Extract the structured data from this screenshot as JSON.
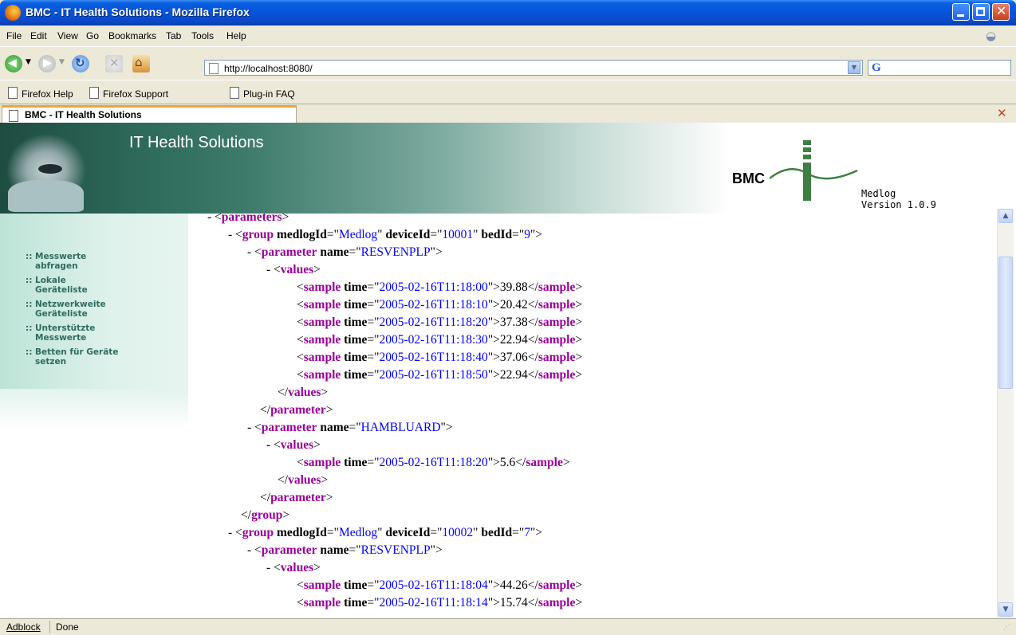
{
  "window": {
    "title": "BMC - IT Health Solutions - Mozilla Firefox"
  },
  "menu": [
    "File",
    "Edit",
    "View",
    "Go",
    "Bookmarks",
    "Tab",
    "Tools",
    "Help"
  ],
  "nav": {
    "url": "http://localhost:8080/",
    "search_engine": "G"
  },
  "bookmarks": [
    "Firefox Help",
    "Firefox Support",
    "Plug-in FAQ"
  ],
  "tab": {
    "label": "BMC - IT Health Solutions"
  },
  "page": {
    "banner_title": "IT Health Solutions",
    "logo_text": "BMC",
    "product": "Medlog",
    "version": "Version 1.0.9",
    "sidebar": [
      {
        "line1": "Messwerte",
        "line2": "abfragen"
      },
      {
        "line1": "Lokale",
        "line2": "Geräteliste"
      },
      {
        "line1": "Netzwerkweite",
        "line2": "Geräteliste"
      },
      {
        "line1": "Unterstützte",
        "line2": "Messwerte"
      },
      {
        "line1": "Betten für Geräte",
        "line2": "setzen"
      }
    ],
    "bullet": "::"
  },
  "xml": {
    "root_tag": "parameters",
    "groups": [
      {
        "medlogId": "Medlog",
        "deviceId": "10001",
        "bedId": "9",
        "parameters": [
          {
            "name": "RESVENPLP",
            "samples": [
              {
                "time": "2005-02-16T11:18:00",
                "value": "39.88"
              },
              {
                "time": "2005-02-16T11:18:10",
                "value": "20.42"
              },
              {
                "time": "2005-02-16T11:18:20",
                "value": "37.38"
              },
              {
                "time": "2005-02-16T11:18:30",
                "value": "22.94"
              },
              {
                "time": "2005-02-16T11:18:40",
                "value": "37.06"
              },
              {
                "time": "2005-02-16T11:18:50",
                "value": "22.94"
              }
            ]
          },
          {
            "name": "HAMBLUARD",
            "samples": [
              {
                "time": "2005-02-16T11:18:20",
                "value": "5.6"
              }
            ]
          }
        ]
      },
      {
        "medlogId": "Medlog",
        "deviceId": "10002",
        "bedId": "7",
        "parameters": [
          {
            "name": "RESVENPLP",
            "samples": [
              {
                "time": "2005-02-16T11:18:04",
                "value": "44.26"
              },
              {
                "time": "2005-02-16T11:18:14",
                "value": "15.74"
              }
            ]
          }
        ]
      }
    ]
  },
  "status": {
    "left": "Adblock",
    "text": "Done"
  },
  "colors": {
    "tag": "#990099",
    "attr_value": "#0000ff",
    "title_bar": "#0653d8"
  }
}
